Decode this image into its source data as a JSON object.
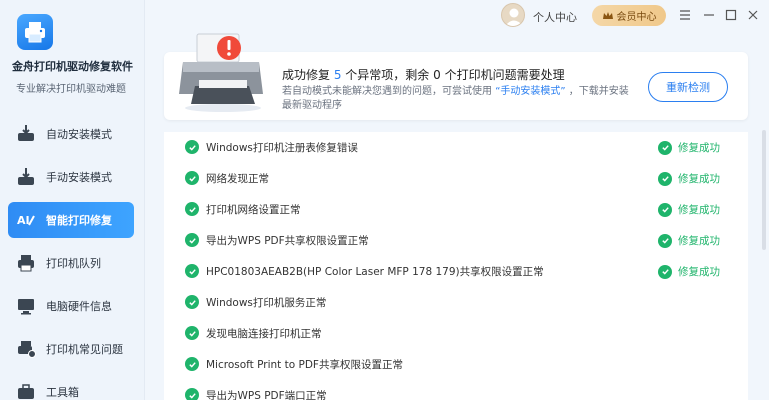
{
  "app": {
    "name": "金舟打印机驱动修复软件",
    "subtitle": "专业解决打印机驱动难题"
  },
  "sidebar": {
    "items": [
      {
        "label": "自动安装模式",
        "icon": "auto-install-icon",
        "active": false
      },
      {
        "label": "手动安装模式",
        "icon": "manual-install-icon",
        "active": false
      },
      {
        "label": "智能打印修复",
        "icon": "smart-repair-icon",
        "active": true
      },
      {
        "label": "打印机队列",
        "icon": "printer-queue-icon",
        "active": false
      },
      {
        "label": "电脑硬件信息",
        "icon": "hardware-info-icon",
        "active": false
      },
      {
        "label": "打印机常见问题",
        "icon": "faq-icon",
        "active": false
      },
      {
        "label": "工具箱",
        "icon": "toolbox-icon",
        "active": false
      }
    ]
  },
  "topbar": {
    "user_center": "个人中心",
    "vip_label": "会员中心"
  },
  "banner": {
    "title_prefix": "成功修复 ",
    "fixed_count": "5",
    "title_mid": " 个异常项，剩余 ",
    "remaining_count": "0",
    "title_suffix": " 个打印机问题需要处理",
    "desc_prefix": "若自动模式未能解决您遇到的问题，可尝试使用 ",
    "desc_link": "“手动安装模式”",
    "desc_suffix": " ，下载并安装最新驱动程序",
    "recheck_label": "重新检测"
  },
  "results": [
    {
      "text": "Windows打印机注册表修复错误",
      "status": "修复成功"
    },
    {
      "text": "网络发现正常",
      "status": "修复成功"
    },
    {
      "text": "打印机网络设置正常",
      "status": "修复成功"
    },
    {
      "text": "导出为WPS PDF共享权限设置正常",
      "status": "修复成功"
    },
    {
      "text": "HPC01803AEAB2B(HP Color Laser MFP 178 179)共享权限设置正常",
      "status": "修复成功"
    },
    {
      "text": "Windows打印机服务正常",
      "status": ""
    },
    {
      "text": "发现电脑连接打印机正常",
      "status": ""
    },
    {
      "text": "Microsoft Print to PDF共享权限设置正常",
      "status": ""
    },
    {
      "text": "导出为WPS PDF端口正常",
      "status": ""
    }
  ],
  "colors": {
    "accent": "#2b7ff0",
    "success": "#1fb46b",
    "vip": "#f0c88a"
  }
}
